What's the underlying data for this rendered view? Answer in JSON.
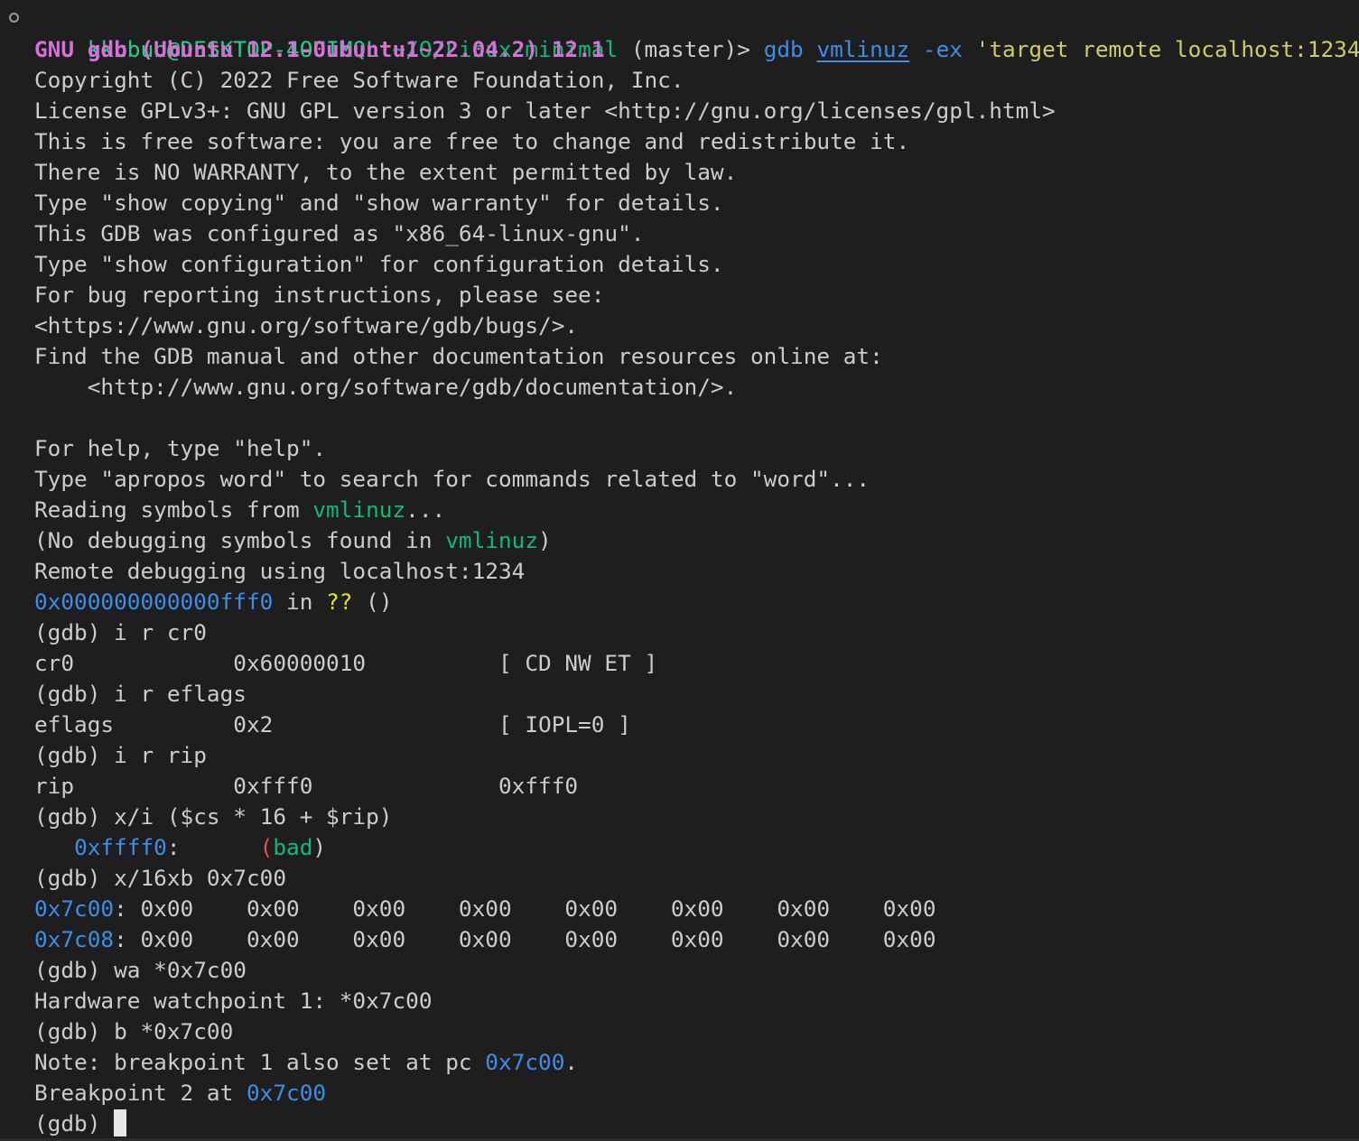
{
  "terminal": {
    "prompt": {
      "user_host": "kkubun@DESKTOP-4OUIMQL",
      "cwd": "~/O/Linux-minimal",
      "branch": "(master)>",
      "cmd": "gdb",
      "arg1": "vmlinuz",
      "flag": "-ex",
      "arg2": "'target remote localhost:1234'"
    },
    "gdb_version": "GNU gdb (Ubuntu 12.1-0ubuntu1~22.04.2) 12.1",
    "banner": [
      "Copyright (C) 2022 Free Software Foundation, Inc.",
      "License GPLv3+: GNU GPL version 3 or later <http://gnu.org/licenses/gpl.html>",
      "This is free software: you are free to change and redistribute it.",
      "There is NO WARRANTY, to the extent permitted by law.",
      "Type \"show copying\" and \"show warranty\" for details.",
      "This GDB was configured as \"x86_64-linux-gnu\".",
      "Type \"show configuration\" for configuration details.",
      "For bug reporting instructions, please see:",
      "<https://www.gnu.org/software/gdb/bugs/>.",
      "Find the GDB manual and other documentation resources online at:",
      "    <http://www.gnu.org/software/gdb/documentation/>.",
      "",
      "For help, type \"help\".",
      "Type \"apropos word\" to search for commands related to \"word\"..."
    ],
    "reading": {
      "pre": "Reading symbols from ",
      "file": "vmlinuz",
      "post": "..."
    },
    "nosym": {
      "pre": "(No debugging symbols found in ",
      "file": "vmlinuz",
      "post": ")"
    },
    "remote": "Remote debugging using localhost:1234",
    "frame": {
      "addr": "0x000000000000fff0",
      "in": " in ",
      "func": "??",
      "args": " ()"
    },
    "cmd_cr0": "(gdb) i r cr0",
    "reg_cr0": "cr0            0x60000010          [ CD NW ET ]",
    "cmd_eflags": "(gdb) i r eflags",
    "reg_eflags": "eflags         0x2                 [ IOPL=0 ]",
    "cmd_rip": "(gdb) i r rip",
    "reg_rip": "rip            0xfff0              0xfff0",
    "cmd_xi": "(gdb) x/i ($cs * 16 + $rip)",
    "disasm": {
      "indent": "   ",
      "addr": "0xffff0",
      "colon": ":      ",
      "paren_open": "(",
      "bad": "bad",
      "paren_close": ")"
    },
    "cmd_xb": "(gdb) x/16xb 0x7c00",
    "mem_rows": [
      {
        "addr": "0x7c00",
        "bytes": ": 0x00    0x00    0x00    0x00    0x00    0x00    0x00    0x00"
      },
      {
        "addr": "0x7c08",
        "bytes": ": 0x00    0x00    0x00    0x00    0x00    0x00    0x00    0x00"
      }
    ],
    "cmd_wa": "(gdb) wa *0x7c00",
    "hw_watch": "Hardware watchpoint 1: *0x7c00",
    "cmd_b": "(gdb) b *0x7c00",
    "note": {
      "pre": "Note: breakpoint 1 also set at pc ",
      "addr": "0x7c00",
      "post": "."
    },
    "bp2": {
      "pre": "Breakpoint 2 at ",
      "addr": "0x7c00"
    },
    "final_prompt": "(gdb) "
  },
  "colors": {
    "background": "#1e1e1e",
    "foreground": "#cccccc",
    "green": "#23d18b",
    "blue": "#3b8eea",
    "magenta": "#d670d6",
    "yellow": "#e5e510",
    "red": "#f14c4c"
  }
}
